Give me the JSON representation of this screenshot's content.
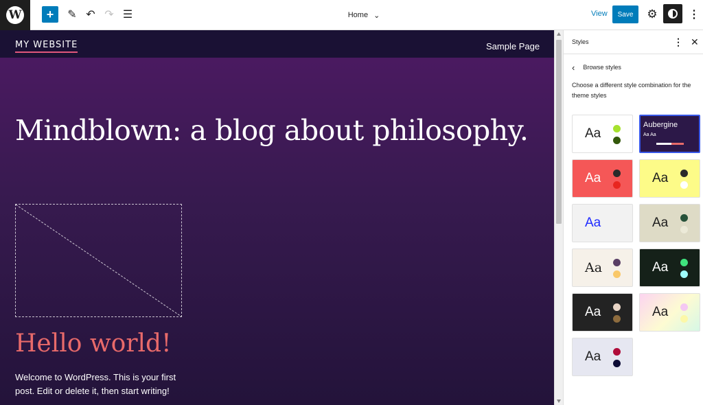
{
  "toolbar": {
    "logo_glyph": "W",
    "add_glyph": "+",
    "tools_glyph": "✎",
    "undo_glyph": "↶",
    "redo_glyph": "↷",
    "list_glyph": "☰",
    "document_title": "Home",
    "document_chevron": "⌄",
    "view_label": "View",
    "save_label": "Save",
    "settings_glyph": "⚙",
    "more_glyph": "⋮"
  },
  "canvas": {
    "site_title": "MY WEBSITE",
    "nav_link": "Sample Page",
    "hero_heading": "Mindblown: a blog about philosophy.",
    "post_title": "Hello world!",
    "post_excerpt": "Welcome to WordPress. This is your first post. Edit or delete it, then start writing!"
  },
  "sidebar": {
    "title": "Styles",
    "more_glyph": "⋮",
    "close_glyph": "✕",
    "back_glyph": "‹",
    "back_label": "Browse styles",
    "description": "Choose a different style combination for the theme styles",
    "variations": [
      {
        "id": "default",
        "label": "Aa",
        "background": "#ffffff",
        "text_color": "#1e1e1e",
        "dot1": "#a6e22e",
        "dot2": "#33580b"
      },
      {
        "id": "aubergine",
        "name": "Aubergine",
        "sample": "Aa Aa",
        "background": "#2c1848",
        "text_color": "#ffffff",
        "selected": true
      },
      {
        "id": "red",
        "label": "Aa",
        "background": "#f55757",
        "text_color": "#ffffff",
        "dot1": "#2a2a2a",
        "dot2": "#e8261f"
      },
      {
        "id": "yellow",
        "label": "Aa",
        "background": "#fdfb88",
        "text_color": "#1e1e1e",
        "dot1": "#2a2a2a",
        "dot2": "#ffffff"
      },
      {
        "id": "blue-light",
        "label": "Aa",
        "background": "#f2f2f2",
        "text_color": "#1f2bff",
        "dot1": "#f2f2f2",
        "dot2": "#f2f2f2"
      },
      {
        "id": "sage",
        "label": "Aa",
        "background": "#dedbc6",
        "text_color": "#1e1e1e",
        "dot1": "#27523a",
        "dot2": "#ecead8"
      },
      {
        "id": "serif-cream",
        "label": "Aa",
        "background": "#f6f1e9",
        "text_color": "#1e1e1e",
        "dot1": "#5a3f66",
        "dot2": "#f9c869"
      },
      {
        "id": "dark-green",
        "label": "Aa",
        "background": "#152119",
        "text_color": "#ffffff",
        "dot1": "#3fe37d",
        "dot2": "#9ffcfb"
      },
      {
        "id": "charcoal",
        "label": "Aa",
        "background": "#232323",
        "text_color": "#ffffff",
        "dot1": "#e7d4c5",
        "dot2": "#8e6c3e"
      },
      {
        "id": "pastel-gradient",
        "label": "Aa",
        "background": "linear-gradient(135deg, #fcd5f0 0%, #fdfbd2 55%, #d6f7e6 100%)",
        "text_color": "#1e1e1e",
        "dot1": "#f4c8f2",
        "dot2": "#fcf8a8"
      },
      {
        "id": "lavender-grey",
        "label": "Aa",
        "background": "#e6e7f1",
        "text_color": "#1e1e1e",
        "dot1": "#b00c3a",
        "dot2": "#0c0b35"
      }
    ]
  },
  "colors": {
    "accent": "#007cba",
    "selection_border": "#3858e9",
    "site_title_underline": "#e3577c",
    "post_title": "#e86a6a"
  }
}
